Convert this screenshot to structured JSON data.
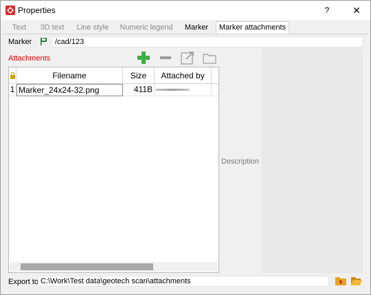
{
  "window": {
    "title": "Properties",
    "help_label": "?",
    "close_label": "✕"
  },
  "tabs": [
    {
      "label": "Text",
      "state": "inactive"
    },
    {
      "label": "3D text",
      "state": "inactive"
    },
    {
      "label": "Line style",
      "state": "inactive"
    },
    {
      "label": "Numeric legend",
      "state": "inactive"
    },
    {
      "label": "Marker",
      "state": "normal"
    },
    {
      "label": "Marker attachments",
      "state": "selected"
    }
  ],
  "marker": {
    "label": "Marker",
    "value": "/cad/123",
    "icon": "flag-icon"
  },
  "attachments": {
    "label": "Attachments",
    "label_color": "#e00000",
    "toolbar": [
      "add-icon",
      "remove-icon",
      "open-external-icon",
      "folder-icon"
    ],
    "columns": [
      "",
      "Filename",
      "Size",
      "Attached by"
    ],
    "rows": [
      {
        "index": "1",
        "filename": "Marker_24x24-32.png",
        "size": "411B",
        "attached_by": ""
      }
    ]
  },
  "description": {
    "label": "Description"
  },
  "export": {
    "label": "Export to",
    "value": "C:\\Work\\Test data\\geotech scan\\attachments"
  },
  "colors": {
    "accent_red": "#d32f2f",
    "add_green": "#3cb043"
  }
}
